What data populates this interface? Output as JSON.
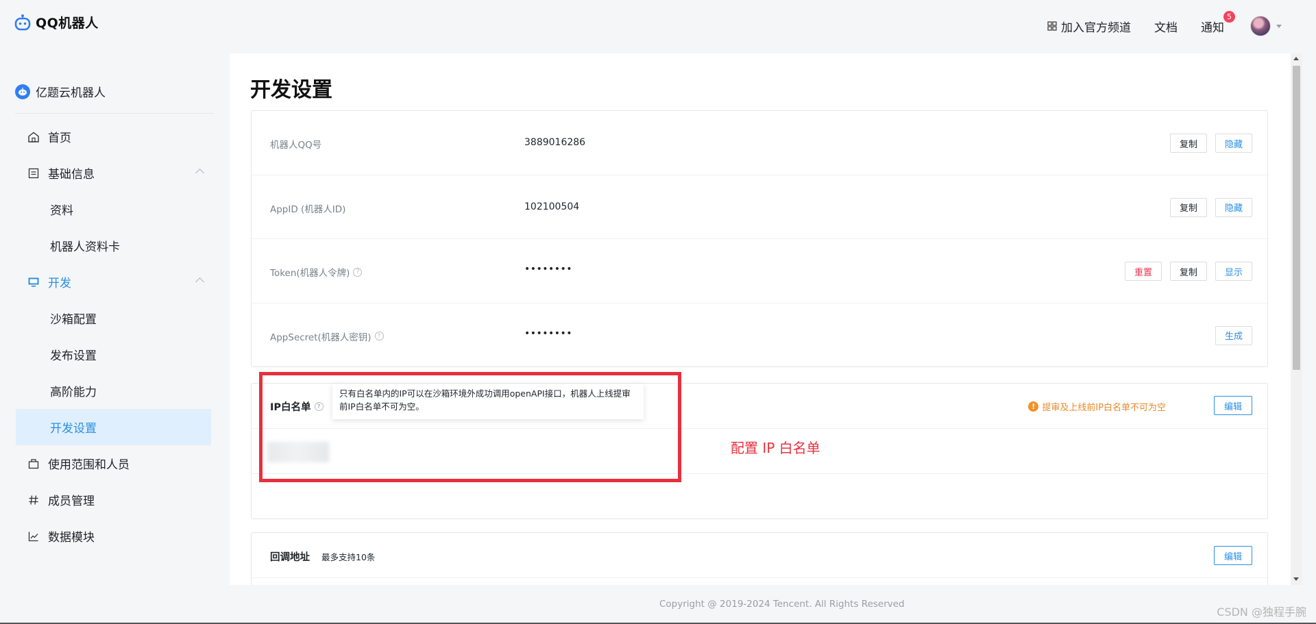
{
  "header": {
    "logo_text": "QQ机器人",
    "links": {
      "channel": "加入官方频道",
      "docs": "文档",
      "notify": "通知",
      "notify_count": "5"
    }
  },
  "sidebar": {
    "bot_name": "亿题云机器人",
    "items": {
      "home": "首页",
      "basic": "基础信息",
      "profile": "资料",
      "card": "机器人资料卡",
      "dev": "开发",
      "sandbox": "沙箱配置",
      "publish": "发布设置",
      "advanced": "高阶能力",
      "devsettings": "开发设置",
      "scope": "使用范围和人员",
      "members": "成员管理",
      "data": "数据模块"
    }
  },
  "main": {
    "title": "开发设置",
    "rows": {
      "qq": {
        "label": "机器人QQ号",
        "value": "3889016286"
      },
      "appid": {
        "label": "AppID (机器人ID)",
        "value": "102100504"
      },
      "token": {
        "label": "Token(机器人令牌)",
        "value": "••••••••"
      },
      "secret": {
        "label": "AppSecret(机器人密钥)",
        "value": "••••••••"
      }
    },
    "buttons": {
      "copy": "复制",
      "hide": "隐藏",
      "reset": "重置",
      "show": "显示",
      "generate": "生成",
      "edit": "编辑"
    },
    "ip": {
      "title": "IP白名单",
      "tooltip": "只有白名单内的IP可以在沙箱环境外成功调用openAPI接口，机器人上线提审前IP白名单不可为空。",
      "warning": "提审及上线前IP白名单不可为空"
    },
    "callback": {
      "title": "回调地址",
      "subtitle": "最多支持10条"
    }
  },
  "annotation": "配置 IP 白名单",
  "footer": "Copyright @ 2019-2024 Tencent. All Rights Reserved",
  "watermark": "CSDN @独程手腕"
}
